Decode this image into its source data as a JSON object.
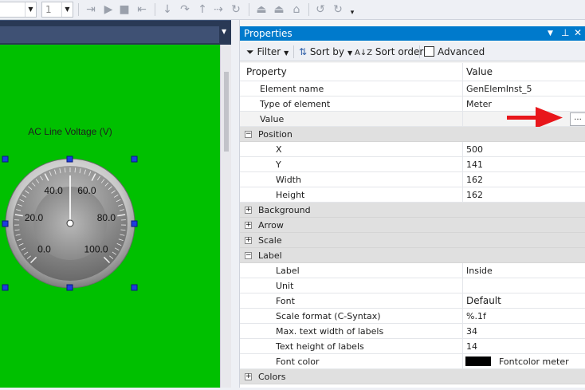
{
  "toolbar": {
    "combo1_value": "",
    "combo2_value": "1"
  },
  "canvas": {
    "background": "#00c000",
    "meter": {
      "title": "AC Line Voltage (V)",
      "labels": [
        "0.0",
        "20.0",
        "40.0",
        "60.0",
        "80.0",
        "100.0"
      ],
      "value": 50
    }
  },
  "properties": {
    "title": "Properties",
    "toolbar": {
      "filter": "Filter",
      "sort_by": "Sort by",
      "sort_order": "Sort order",
      "advanced": "Advanced"
    },
    "columns": {
      "property": "Property",
      "value": "Value"
    },
    "rows": [
      {
        "name": "Element name",
        "value": "GenElemInst_5"
      },
      {
        "name": "Type of element",
        "value": "Meter"
      },
      {
        "name": "Value",
        "value": ""
      }
    ],
    "position": {
      "label": "Position",
      "rows": [
        {
          "name": "X",
          "value": "500"
        },
        {
          "name": "Y",
          "value": "141"
        },
        {
          "name": "Width",
          "value": "162"
        },
        {
          "name": "Height",
          "value": "162"
        }
      ]
    },
    "categories": {
      "background": "Background",
      "arrow": "Arrow",
      "scale": "Scale",
      "label": "Label",
      "colors": "Colors"
    },
    "label_rows": [
      {
        "name": "Label",
        "value": "Inside"
      },
      {
        "name": "Unit",
        "value": ""
      },
      {
        "name": "Font",
        "value": "Default"
      },
      {
        "name": "Scale format (C-Syntax)",
        "value": "%.1f"
      },
      {
        "name": "Max. text width of labels",
        "value": "34"
      },
      {
        "name": "Text height of labels",
        "value": "14"
      },
      {
        "name": "Font color",
        "value": "Fontcolor meter"
      }
    ],
    "ellipsis": "...",
    "accent": "#007acc",
    "arrow_color": "#e8161b"
  }
}
